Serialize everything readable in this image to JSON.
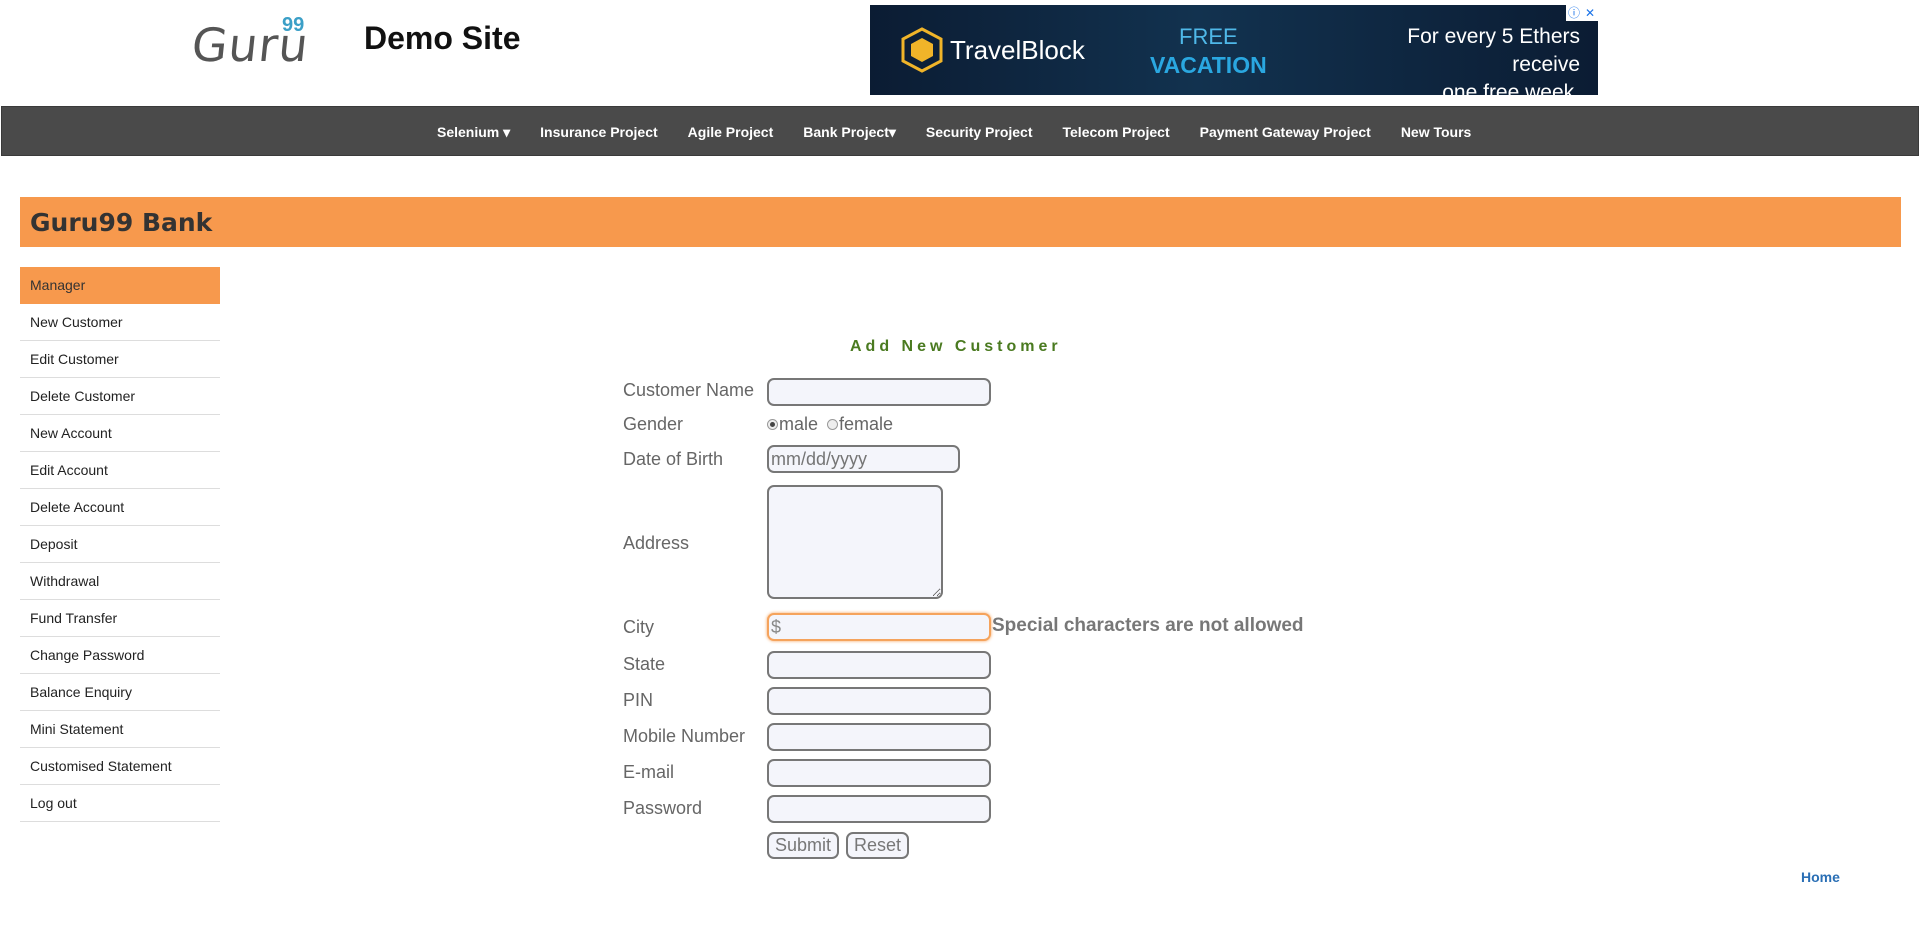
{
  "header": {
    "logo_text": "Guru",
    "logo_sup": "99",
    "site_title": "Demo Site"
  },
  "ad": {
    "brand": "TravelBlock",
    "free_line1": "FREE",
    "free_line2": "VACATION",
    "offer_line1": "For every 5 Ethers receive",
    "offer_line2": "one free week."
  },
  "nav": {
    "items": [
      "Selenium ▾",
      "Insurance Project",
      "Agile Project",
      "Bank Project▾",
      "Security Project",
      "Telecom Project",
      "Payment Gateway Project",
      "New Tours"
    ]
  },
  "banner": {
    "title": "Guru99 Bank"
  },
  "sidebar": {
    "items": [
      "Manager",
      "New Customer",
      "Edit Customer",
      "Delete Customer",
      "New Account",
      "Edit Account",
      "Delete Account",
      "Deposit",
      "Withdrawal",
      "Fund Transfer",
      "Change Password",
      "Balance Enquiry",
      "Mini Statement",
      "Customised Statement",
      "Log out"
    ]
  },
  "form": {
    "title": "Add New Customer",
    "labels": {
      "name": "Customer Name",
      "gender": "Gender",
      "dob": "Date of Birth",
      "address": "Address",
      "city": "City",
      "state": "State",
      "pin": "PIN",
      "mobile": "Mobile Number",
      "email": "E-mail",
      "password": "Password"
    },
    "gender_options": {
      "male": "male",
      "female": "female",
      "selected": "male"
    },
    "dob_placeholder": "mm/dd/yyyy",
    "city_value": "$",
    "city_error": "Special characters are not allowed",
    "submit": "Submit",
    "reset": "Reset"
  },
  "footer": {
    "home_link": "Home"
  },
  "colors": {
    "accent": "#f7994d",
    "nav_bg": "#4a4a4a",
    "form_title": "#4a7a20",
    "link": "#2a6fb5"
  }
}
